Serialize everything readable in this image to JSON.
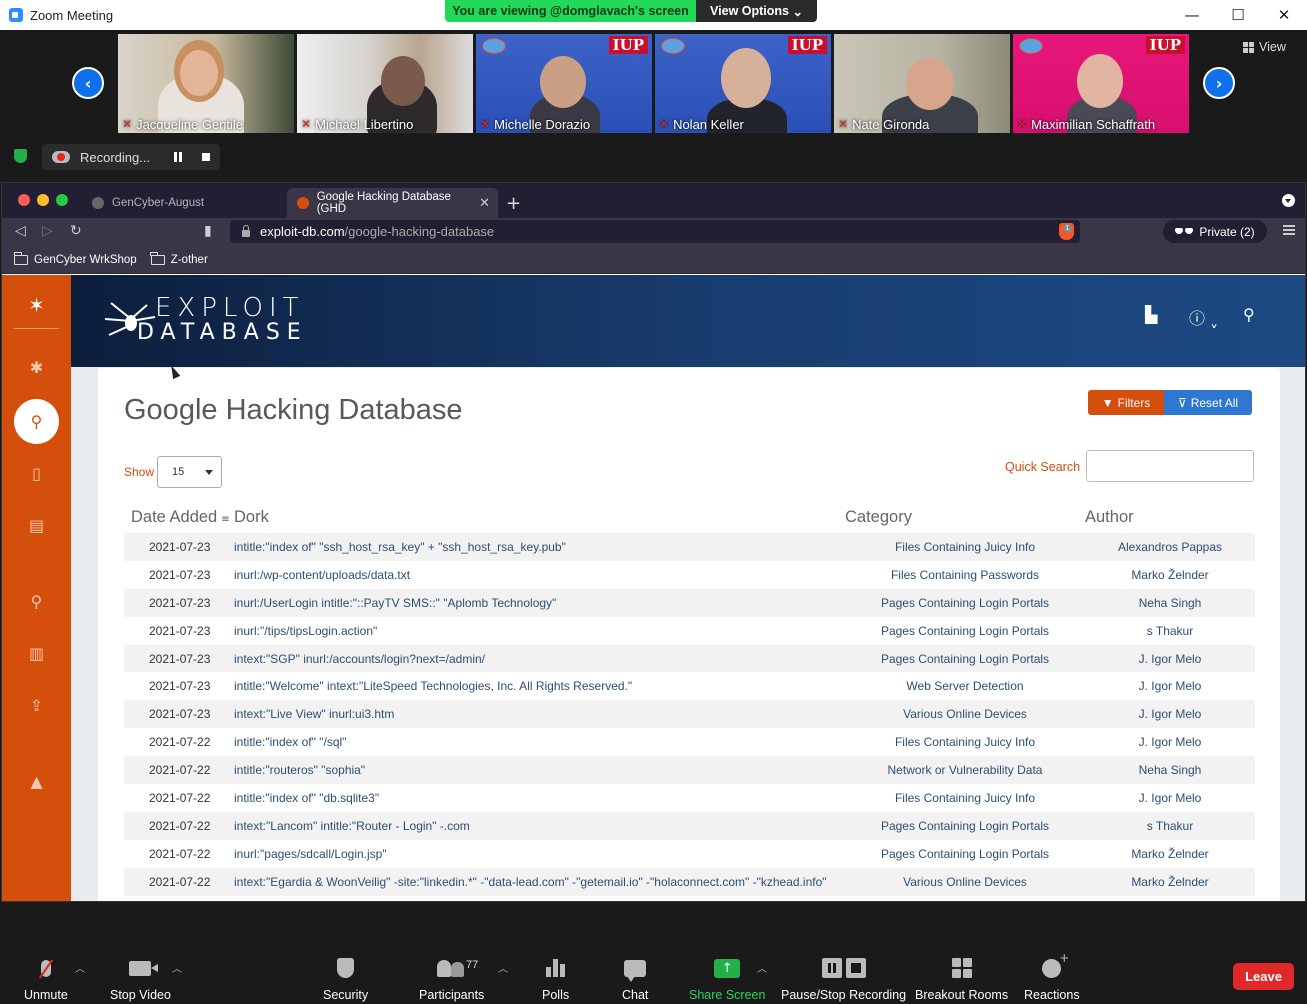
{
  "zoom": {
    "window_title": "Zoom Meeting",
    "viewing_banner": "You are viewing @domglavach's screen",
    "view_options": "View Options",
    "view_label": "View",
    "recording_text": "Recording...",
    "participants": [
      {
        "name": "Jacqueline Gentile"
      },
      {
        "name": "Michael Libertino"
      },
      {
        "name": "Michelle Dorazio"
      },
      {
        "name": "Nolan Keller"
      },
      {
        "name": "Nate Gironda"
      },
      {
        "name": "Maximilian Schaffrath"
      }
    ],
    "iup_badge": "IUP",
    "toolbar": {
      "unmute": "Unmute",
      "stop_video": "Stop Video",
      "security": "Security",
      "participants": "Participants",
      "participants_count": "77",
      "polls": "Polls",
      "chat": "Chat",
      "share_screen": "Share Screen",
      "pause_stop_recording": "Pause/Stop Recording",
      "breakout_rooms": "Breakout Rooms",
      "reactions": "Reactions",
      "leave": "Leave"
    }
  },
  "browser": {
    "tabs": [
      {
        "title": "GenCyber-August"
      },
      {
        "title": "Google Hacking Database (GHD"
      }
    ],
    "url_host": "exploit-db.com",
    "url_path": "/google-hacking-database",
    "brave_count": "1",
    "private_label": "Private (2)",
    "bookmarks": [
      "GenCyber WrkShop",
      "Z-other"
    ]
  },
  "site": {
    "logo_line1": "EXPLOIT",
    "logo_line2": "DATABASE",
    "page_title": "Google Hacking Database",
    "filters_label": "Filters",
    "reset_label": "Reset All",
    "show_label": "Show",
    "show_value": "15",
    "quick_search_label": "Quick Search",
    "quick_search_value": "",
    "columns": {
      "date": "Date Added",
      "dork": "Dork",
      "category": "Category",
      "author": "Author"
    },
    "rows": [
      {
        "date": "2021-07-23",
        "dork": "intitle:\"index of\" \"ssh_host_rsa_key\" + \"ssh_host_rsa_key.pub\"",
        "category": "Files Containing Juicy Info",
        "author": "Alexandros Pappas"
      },
      {
        "date": "2021-07-23",
        "dork": "inurl:/wp-content/uploads/data.txt",
        "category": "Files Containing Passwords",
        "author": "Marko Želnder"
      },
      {
        "date": "2021-07-23",
        "dork": "inurl:/UserLogin intitle:\"::PayTV SMS::\" \"Aplomb Technology\"",
        "category": "Pages Containing Login Portals",
        "author": "Neha Singh"
      },
      {
        "date": "2021-07-23",
        "dork": "inurl:\"/tips/tipsLogin.action\"",
        "category": "Pages Containing Login Portals",
        "author": "s Thakur"
      },
      {
        "date": "2021-07-23",
        "dork": "intext:\"SGP\" inurl:/accounts/login?next=/admin/",
        "category": "Pages Containing Login Portals",
        "author": "J. Igor Melo"
      },
      {
        "date": "2021-07-23",
        "dork": "intitle:\"Welcome\" intext:\"LiteSpeed Technologies, Inc. All Rights Reserved.\"",
        "category": "Web Server Detection",
        "author": "J. Igor Melo"
      },
      {
        "date": "2021-07-23",
        "dork": "intext:\"Live View\" inurl:ui3.htm",
        "category": "Various Online Devices",
        "author": "J. Igor Melo"
      },
      {
        "date": "2021-07-22",
        "dork": "intitle:\"index of\" \"/sql\"",
        "category": "Files Containing Juicy Info",
        "author": "J. Igor Melo"
      },
      {
        "date": "2021-07-22",
        "dork": "intitle:\"routeros\" \"sophia\"",
        "category": "Network or Vulnerability Data",
        "author": "Neha Singh"
      },
      {
        "date": "2021-07-22",
        "dork": "intitle:\"index of\" \"db.sqlite3\"",
        "category": "Files Containing Juicy Info",
        "author": "J. Igor Melo"
      },
      {
        "date": "2021-07-22",
        "dork": "intext:\"Lancom\" intitle:\"Router - Login\" -.com",
        "category": "Pages Containing Login Portals",
        "author": "s Thakur"
      },
      {
        "date": "2021-07-22",
        "dork": "inurl:\"pages/sdcall/Login.jsp\"",
        "category": "Pages Containing Login Portals",
        "author": "Marko Želnder"
      },
      {
        "date": "2021-07-22",
        "dork": "intext:\"Egardia & WoonVeilig\" -site:\"linkedin.*\" -\"data-lead.com\" -\"getemail.io\" -\"holaconnect.com\" -\"kzhead.info\"",
        "category": "Various Online Devices",
        "author": "Marko Želnder"
      }
    ]
  },
  "colors": {
    "exploit_orange": "#d44e0c",
    "reset_blue": "#2e78d2",
    "zoom_green": "#23d959",
    "leave_red": "#e02828"
  }
}
